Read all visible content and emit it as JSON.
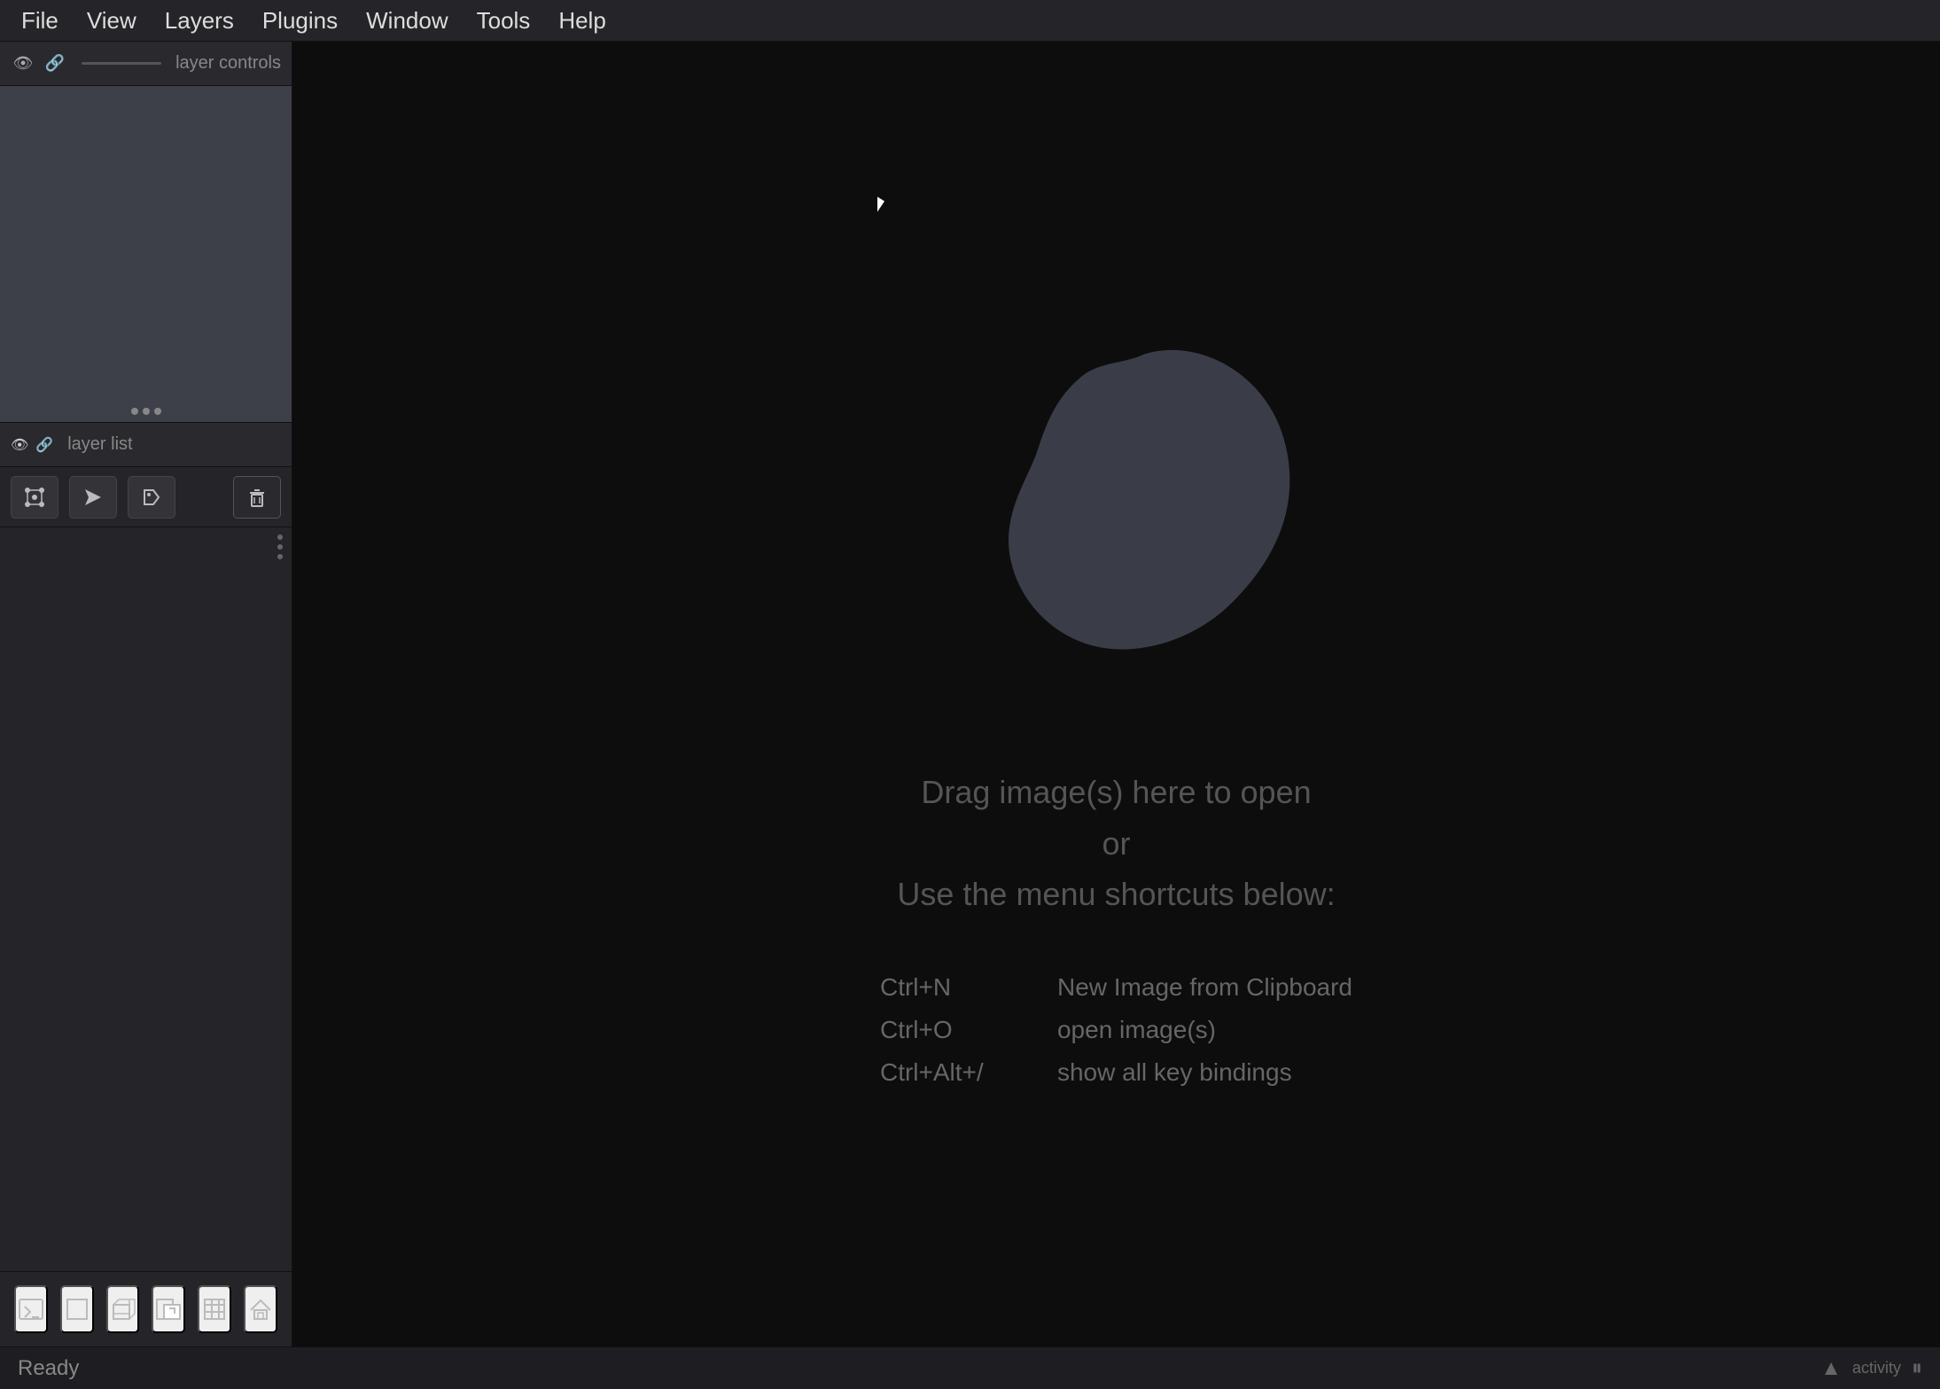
{
  "menubar": {
    "items": [
      "File",
      "View",
      "Layers",
      "Plugins",
      "Window",
      "Tools",
      "Help"
    ]
  },
  "sidebar": {
    "layer_controls_label": "layer controls",
    "layer_list_label": "layer list",
    "tools": {
      "nodes_btn": "⣿",
      "arrow_btn": "▶",
      "tag_btn": "◈",
      "delete_btn": "🗑"
    },
    "preview_dots": 3
  },
  "canvas": {
    "drop_text_line1": "Drag image(s) here to open",
    "drop_text_line2": "or",
    "drop_text_line3": "Use the menu shortcuts below:",
    "shortcuts": [
      {
        "key": "Ctrl+N",
        "desc": "New Image from Clipboard"
      },
      {
        "key": "Ctrl+O",
        "desc": "open image(s)"
      },
      {
        "key": "Ctrl+Alt+/",
        "desc": "show all key bindings"
      }
    ]
  },
  "bottom_toolbar": {
    "items": [
      "terminal",
      "square",
      "box-3d",
      "export",
      "grid",
      "home"
    ]
  },
  "statusbar": {
    "ready_label": "Ready",
    "activity_label": "activity"
  }
}
